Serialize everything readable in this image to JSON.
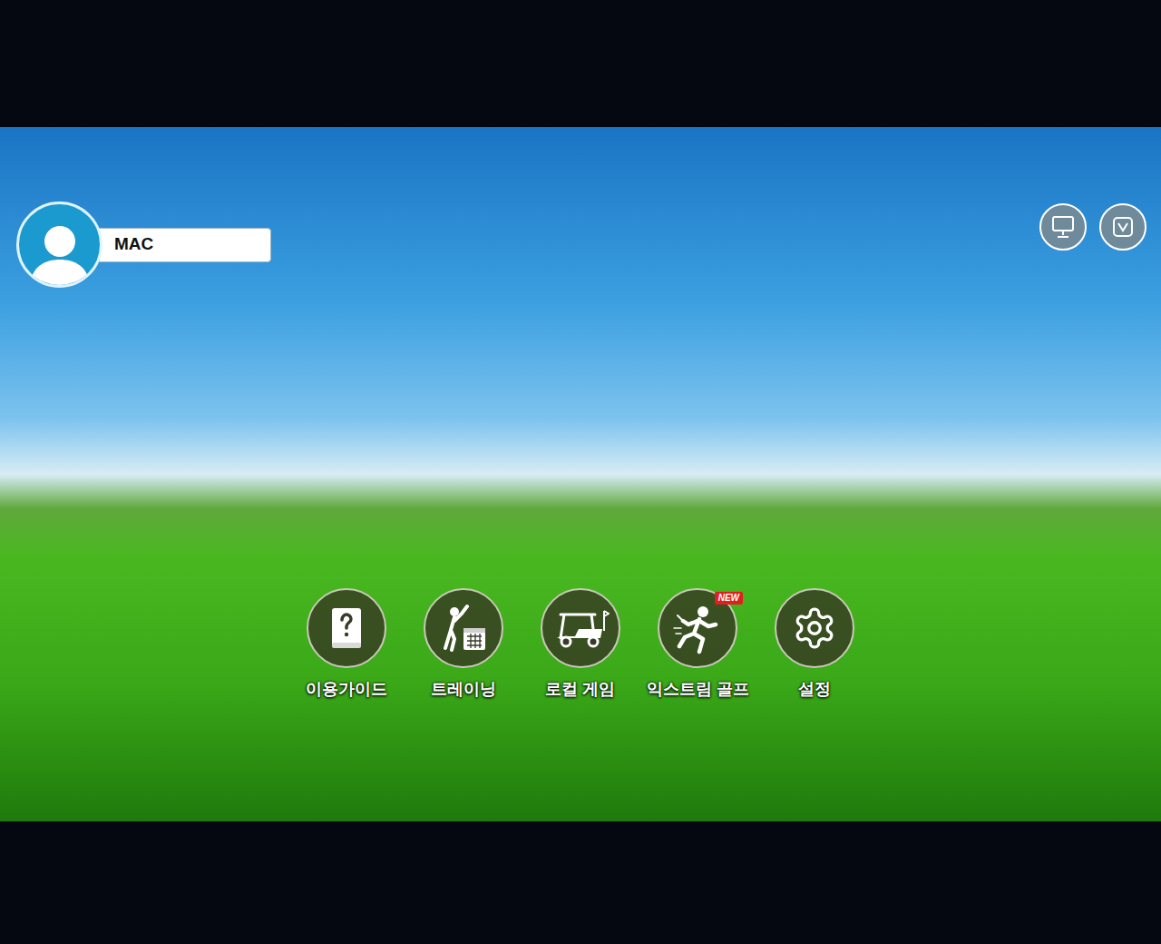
{
  "profile": {
    "name": "MAC"
  },
  "menu": [
    {
      "label": "이용가이드",
      "badge": ""
    },
    {
      "label": "트레이닝",
      "badge": ""
    },
    {
      "label": "로컬 게임",
      "badge": ""
    },
    {
      "label": "익스트림 골프",
      "badge": "NEW"
    },
    {
      "label": "설정",
      "badge": ""
    }
  ]
}
